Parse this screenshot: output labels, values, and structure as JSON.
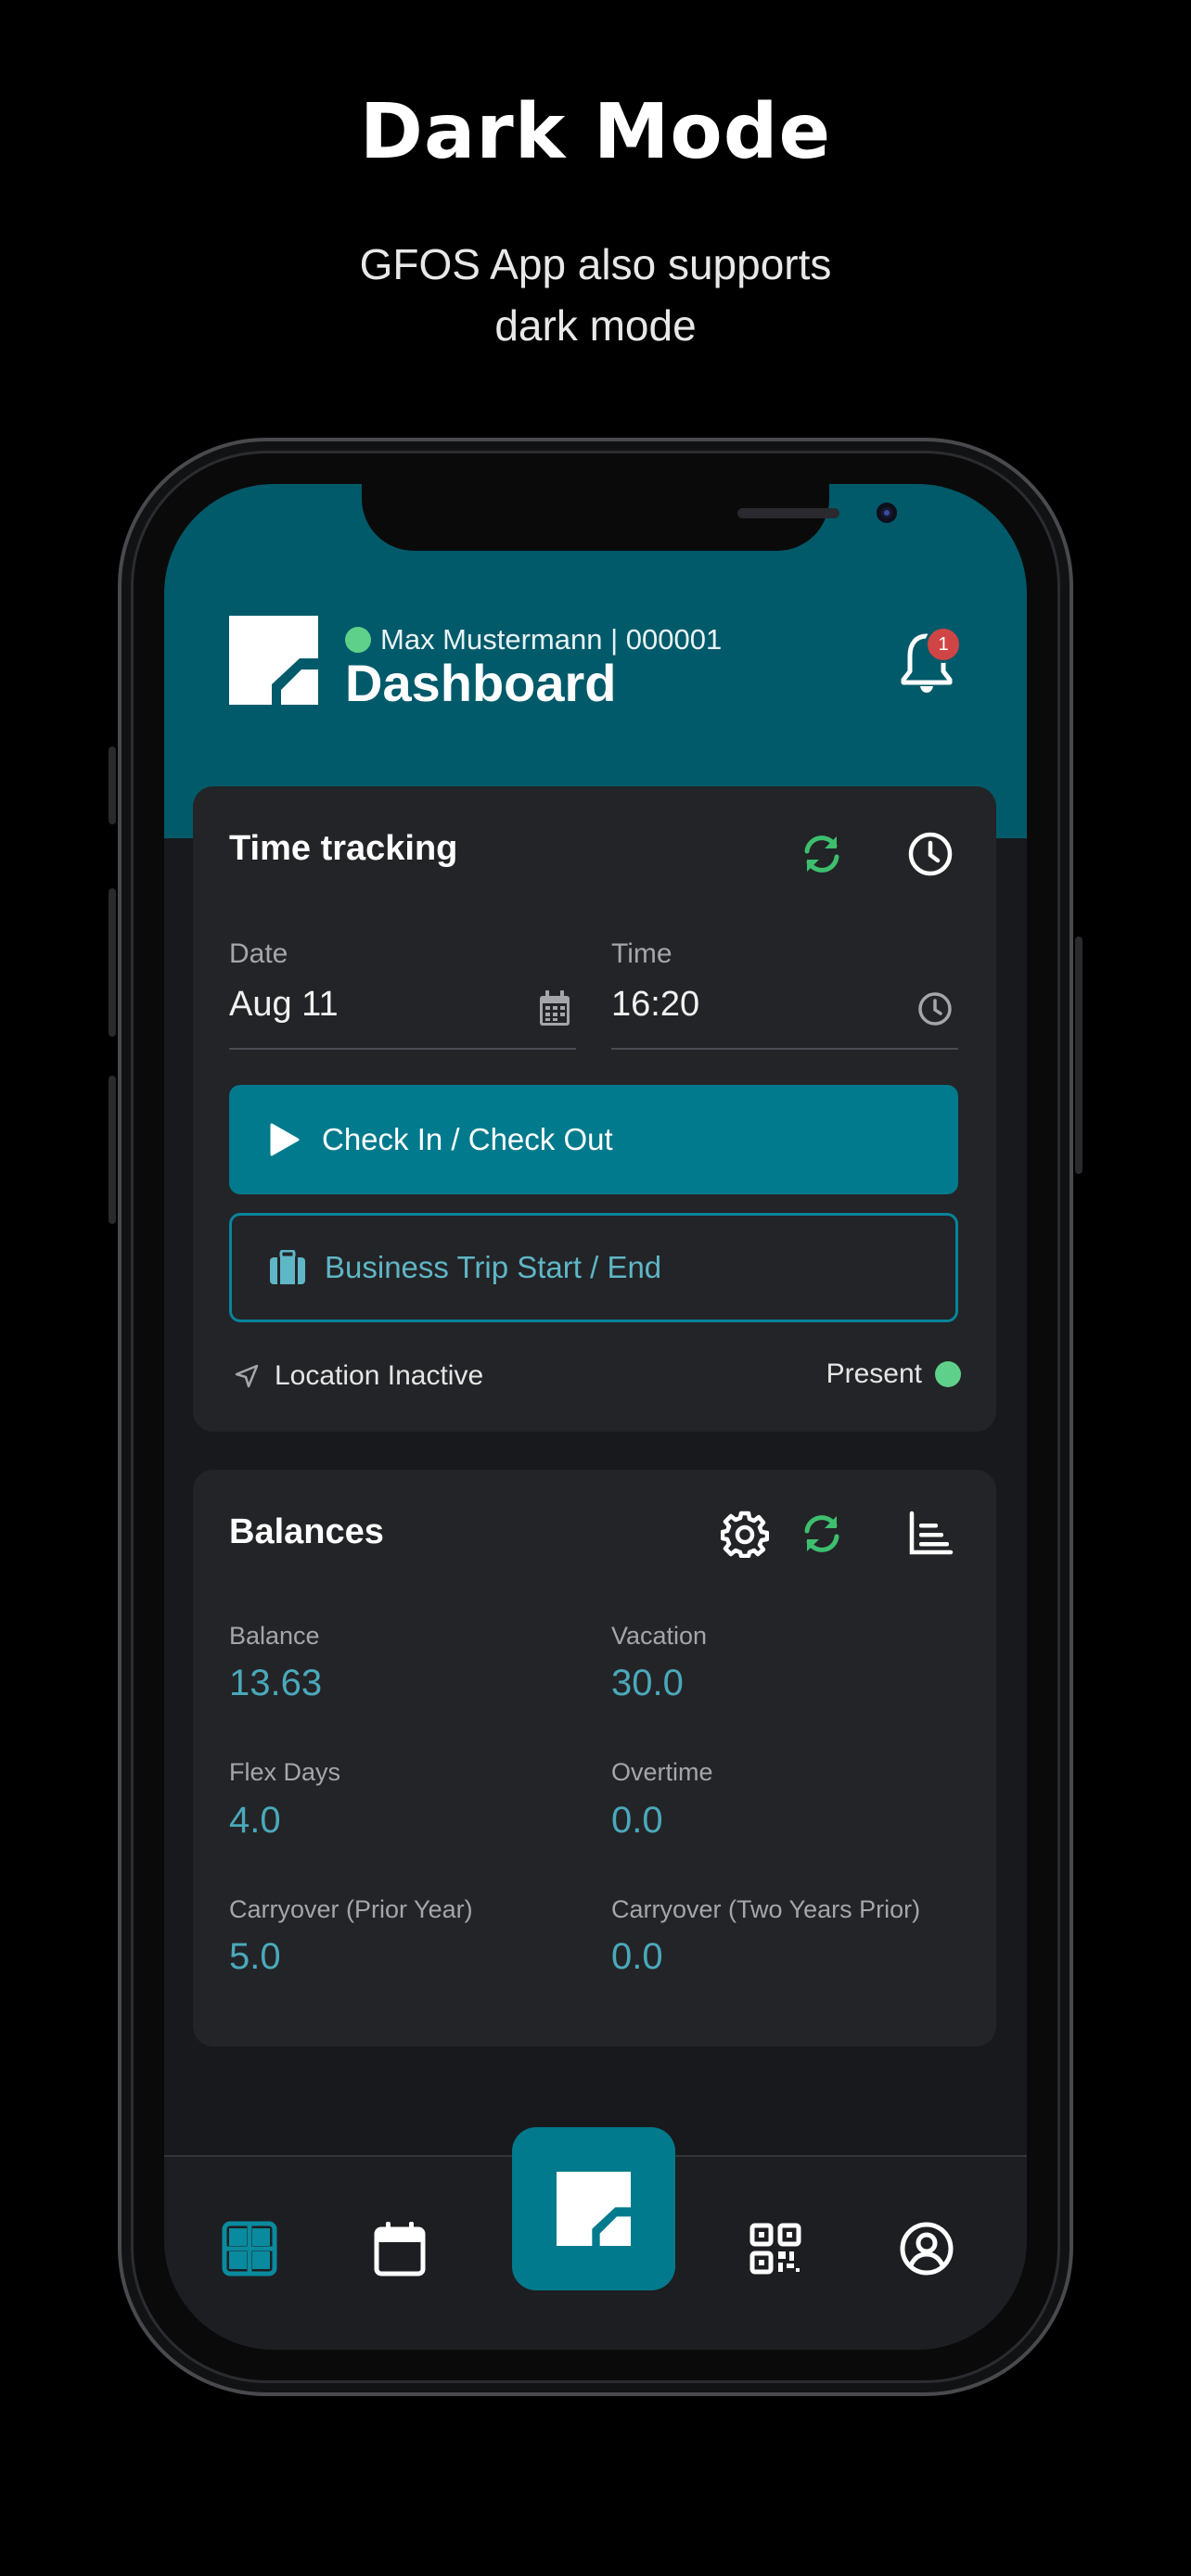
{
  "promo": {
    "title": "Dark Mode",
    "subtitle_line1": "GFOS App also supports",
    "subtitle_line2": "dark mode"
  },
  "colors": {
    "hero_teal": "#005a6a",
    "primary_teal": "#007a8c",
    "value_teal": "#4aa9bb",
    "status_green": "#5fd08a",
    "badge_red": "#cf4545",
    "card_bg": "#232427",
    "screen_bg": "#18191c"
  },
  "header": {
    "user": "Max Mustermann | 000001",
    "title": "Dashboard",
    "notification_count": "1",
    "icons": [
      "app-logo-icon",
      "bell-icon"
    ]
  },
  "time_tracking": {
    "title": "Time tracking",
    "date_label": "Date",
    "date_value": "Aug 11",
    "time_label": "Time",
    "time_value": "16:20",
    "check_button": "Check In / Check Out",
    "trip_button": "Business Trip Start / End",
    "location_status": "Location Inactive",
    "presence_status": "Present",
    "icons": [
      "refresh-icon",
      "clock-icon",
      "calendar-icon",
      "play-icon",
      "suitcase-icon",
      "location-arrow-icon"
    ]
  },
  "balances": {
    "title": "Balances",
    "items": [
      {
        "label": "Balance",
        "value": "13.63"
      },
      {
        "label": "Vacation",
        "value": "30.0"
      },
      {
        "label": "Flex Days",
        "value": "4.0"
      },
      {
        "label": "Overtime",
        "value": "0.0"
      },
      {
        "label": "Carryover (Prior Year)",
        "value": "5.0"
      },
      {
        "label": "Carryover (Two Years Prior)",
        "value": "0.0"
      }
    ],
    "icons": [
      "gear-icon",
      "refresh-icon",
      "bar-chart-icon"
    ]
  },
  "nav": {
    "items": [
      "dashboard-grid-icon",
      "calendar-icon",
      "app-logo-icon",
      "qr-code-icon",
      "user-profile-icon"
    ],
    "active": "dashboard-grid-icon"
  }
}
